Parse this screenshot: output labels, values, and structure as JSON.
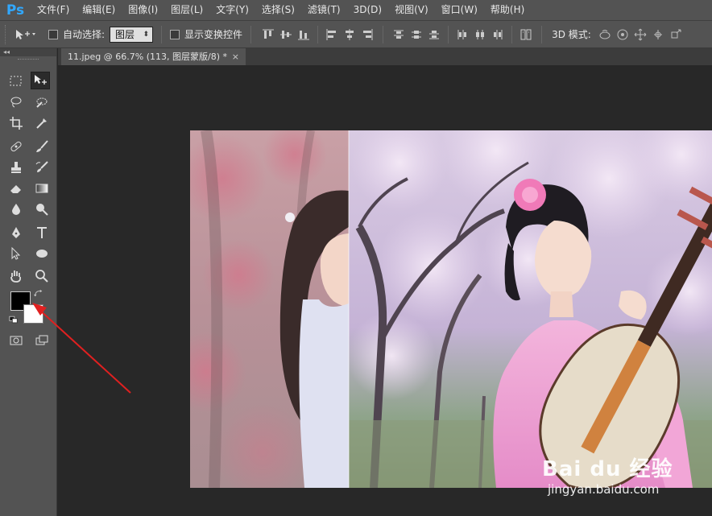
{
  "app": {
    "logo": "Ps"
  },
  "menu": [
    "文件(F)",
    "编辑(E)",
    "图像(I)",
    "图层(L)",
    "文字(Y)",
    "选择(S)",
    "滤镜(T)",
    "3D(D)",
    "视图(V)",
    "窗口(W)",
    "帮助(H)"
  ],
  "options": {
    "auto_select_label": "自动选择:",
    "auto_select_checked": false,
    "auto_select_value": "图层",
    "show_transform_label": "显示变换控件",
    "show_transform_checked": false,
    "mode_label": "3D 模式:"
  },
  "tools_panel": {
    "collapse_label": "◂◂"
  },
  "document": {
    "tab_title": "11.jpeg @ 66.7% (113, 图层蒙版/8) *",
    "close_label": "×"
  },
  "colors": {
    "foreground": "#000000",
    "background": "#ffffff",
    "annotation_arrow": "#e02020",
    "accent": "#31a8ff"
  },
  "watermark": {
    "brand": "Bai du 经验",
    "url": "jingyan.baidu.com"
  }
}
